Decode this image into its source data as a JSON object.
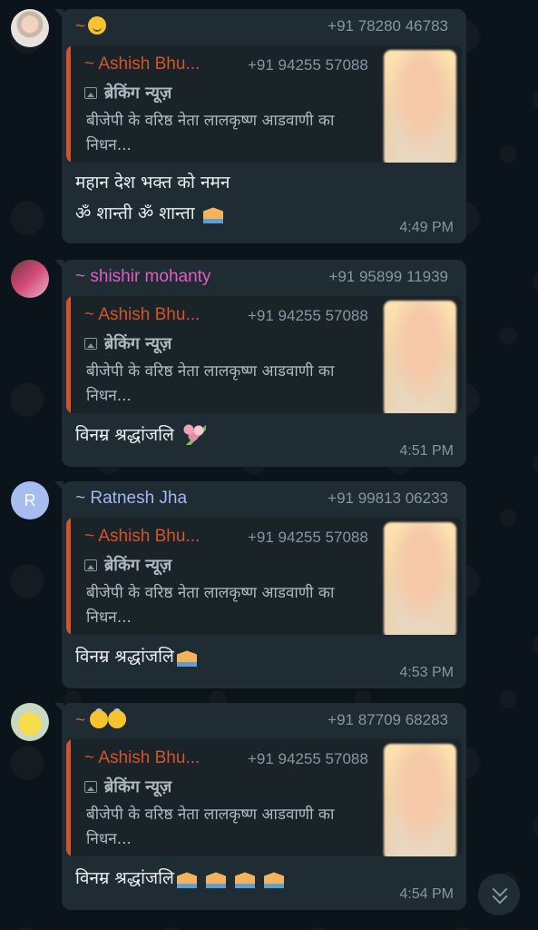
{
  "messages": [
    {
      "sender": "~",
      "sender_color": "#e55e3a",
      "sender_emoji": "smile-emoji",
      "phone": "+91 78280 46783",
      "quote": {
        "sender": "~ Ashish Bhu...",
        "phone": "+91 94255 57088",
        "title": "ब्रेकिंग न्यूज़",
        "body": "बीजेपी के वरिष्ठ नेता लालकृष्ण आडवाणी का निधन..."
      },
      "lines": [
        "महान देश भक्त को नमन",
        "ॐ शान्ती ॐ शान्ता"
      ],
      "time": "4:49 PM"
    },
    {
      "sender": "~ shishir mohanty",
      "sender_color": "#e05ec0",
      "phone": "+91 95899 11939",
      "quote": {
        "sender": "~ Ashish Bhu...",
        "phone": "+91 94255 57088",
        "title": "ब्रेकिंग न्यूज़",
        "body": "बीजेपी के वरिष्ठ नेता लालकृष्ण आडवाणी का निधन..."
      },
      "lines": [
        "विनम्र श्रद्धांजलि"
      ],
      "time": "4:51 PM"
    },
    {
      "sender": "~ Ratnesh Jha",
      "sender_color": "#a5b6f4",
      "avatar_letter": "R",
      "phone": "+91 99813 06233",
      "quote": {
        "sender": "~ Ashish Bhu...",
        "phone": "+91 94255 57088",
        "title": "ब्रेकिंग न्यूज़",
        "body": "बीजेपी के वरिष्ठ नेता लालकृष्ण आडवाणी का निधन..."
      },
      "lines": [
        "विनम्र श्रद्धांजलि"
      ],
      "time": "4:53 PM"
    },
    {
      "sender": "~",
      "sender_color": "#e55e3a",
      "sender_emoji": "halo-emoji",
      "phone": "+91 87709 68283",
      "quote": {
        "sender": "~ Ashish Bhu...",
        "phone": "+91 94255 57088",
        "title": "ब्रेकिंग न्यूज़",
        "body": "बीजेपी के वरिष्ठ नेता लालकृष्ण आडवाणी का निधन..."
      },
      "lines": [
        "विनम्र श्रद्धांजलि"
      ],
      "time": "4:54 PM"
    }
  ],
  "scroll_button_icon": "double-chevron-down-icon",
  "colors": {
    "background": "#0b141a",
    "bubble": "#202c33",
    "quote_bar": "#d4532d",
    "meta_text": "#8696a0"
  }
}
